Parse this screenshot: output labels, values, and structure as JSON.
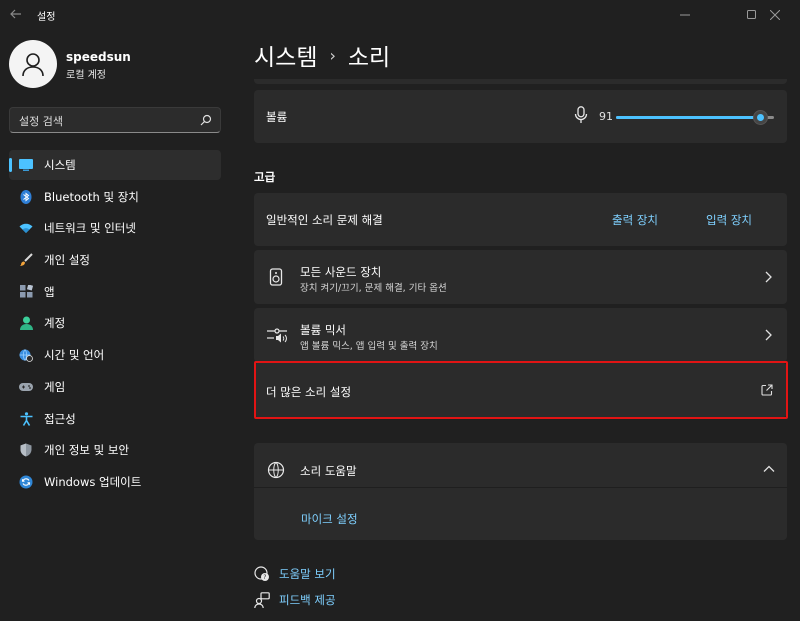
{
  "window": {
    "title": "설정"
  },
  "profile": {
    "name": "speedsun",
    "account_type": "로컬 계정"
  },
  "search": {
    "placeholder": "설정 검색"
  },
  "nav": {
    "items": [
      {
        "label": "시스템",
        "icon": "system-icon",
        "active": true
      },
      {
        "label": "Bluetooth 및 장치",
        "icon": "bluetooth-icon"
      },
      {
        "label": "네트워크 및 인터넷",
        "icon": "wifi-icon"
      },
      {
        "label": "개인 설정",
        "icon": "brush-icon"
      },
      {
        "label": "앱",
        "icon": "apps-icon"
      },
      {
        "label": "계정",
        "icon": "account-icon"
      },
      {
        "label": "시간 및 언어",
        "icon": "globe-clock-icon"
      },
      {
        "label": "게임",
        "icon": "gamepad-icon"
      },
      {
        "label": "접근성",
        "icon": "accessibility-icon"
      },
      {
        "label": "개인 정보 및 보안",
        "icon": "shield-icon"
      },
      {
        "label": "Windows 업데이트",
        "icon": "update-icon"
      }
    ]
  },
  "breadcrumb": {
    "parent": "시스템",
    "separator": "›",
    "current": "소리"
  },
  "volume": {
    "label": "볼륨",
    "value": "91",
    "level": 91
  },
  "advanced": {
    "title": "고급",
    "troubleshoot": {
      "label": "일반적인 소리 문제 해결",
      "output_link": "출력 장치",
      "input_link": "입력 장치"
    },
    "all_devices": {
      "title": "모든 사운드 장치",
      "subtitle": "장치 켜기/끄기, 문제 해결, 기타 옵션"
    },
    "mixer": {
      "title": "볼륨 믹서",
      "subtitle": "앱 볼륨 믹스, 앱 입력 및 출력 장치"
    },
    "more_settings": {
      "label": "더 많은 소리 설정"
    }
  },
  "help": {
    "title": "소리 도움말",
    "link": "마이크 설정"
  },
  "footer": {
    "get_help": "도움말 보기",
    "feedback": "피드백 제공"
  },
  "colors": {
    "accent": "#4cc2ff",
    "link": "#7fd0ff",
    "highlight": "#e11414",
    "card": "#2b2b2b",
    "background": "#202020"
  }
}
